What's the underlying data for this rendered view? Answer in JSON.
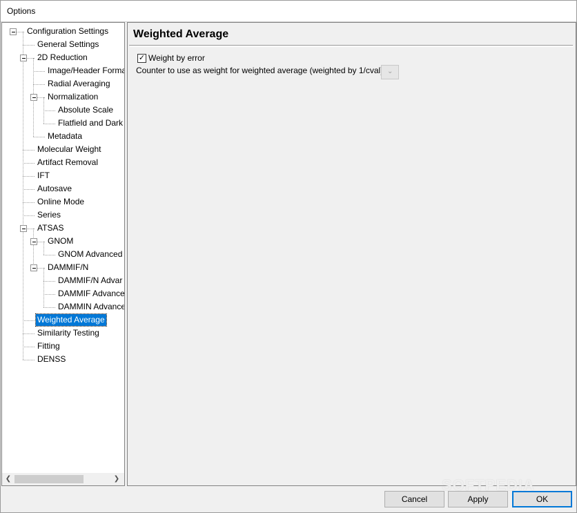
{
  "window": {
    "title": "Options"
  },
  "tree": {
    "items": [
      {
        "label": "Configuration Settings",
        "depth": 0,
        "expander": true
      },
      {
        "label": "General Settings",
        "depth": 1
      },
      {
        "label": "2D Reduction",
        "depth": 1,
        "expander": true
      },
      {
        "label": "Image/Header Forma",
        "depth": 2
      },
      {
        "label": "Radial Averaging",
        "depth": 2
      },
      {
        "label": "Normalization",
        "depth": 2,
        "expander": true
      },
      {
        "label": "Absolute Scale",
        "depth": 3
      },
      {
        "label": "Flatfield and Dark",
        "depth": 3
      },
      {
        "label": "Metadata",
        "depth": 2
      },
      {
        "label": "Molecular Weight",
        "depth": 1
      },
      {
        "label": "Artifact Removal",
        "depth": 1
      },
      {
        "label": "IFT",
        "depth": 1
      },
      {
        "label": "Autosave",
        "depth": 1
      },
      {
        "label": "Online Mode",
        "depth": 1
      },
      {
        "label": "Series",
        "depth": 1
      },
      {
        "label": "ATSAS",
        "depth": 1,
        "expander": true
      },
      {
        "label": "GNOM",
        "depth": 2,
        "expander": true
      },
      {
        "label": "GNOM Advanced",
        "depth": 3
      },
      {
        "label": "DAMMIF/N",
        "depth": 2,
        "expander": true
      },
      {
        "label": "DAMMIF/N Advar",
        "depth": 3
      },
      {
        "label": "DAMMIF Advance",
        "depth": 3
      },
      {
        "label": "DAMMIN Advance",
        "depth": 3
      },
      {
        "label": "Weighted Average",
        "depth": 1,
        "selected": true
      },
      {
        "label": "Similarity Testing",
        "depth": 1
      },
      {
        "label": "Fitting",
        "depth": 1
      },
      {
        "label": "DENSS",
        "depth": 1
      }
    ],
    "scroll_left_icon": "chevron-left-icon",
    "scroll_right_icon": "chevron-right-icon"
  },
  "panel": {
    "title": "Weighted Average",
    "weight_by_error_label": "Weight by error",
    "weight_by_error_checked": true,
    "counter_label": "Counter to use as weight for weighted average (weighted by 1/cval)",
    "counter_value": ""
  },
  "buttons": {
    "cancel": "Cancel",
    "apply": "Apply",
    "ok": "OK"
  },
  "watermark": "SOFTPEDIA",
  "colors": {
    "selection": "#0078d7",
    "button_bg": "#e1e1e1"
  }
}
